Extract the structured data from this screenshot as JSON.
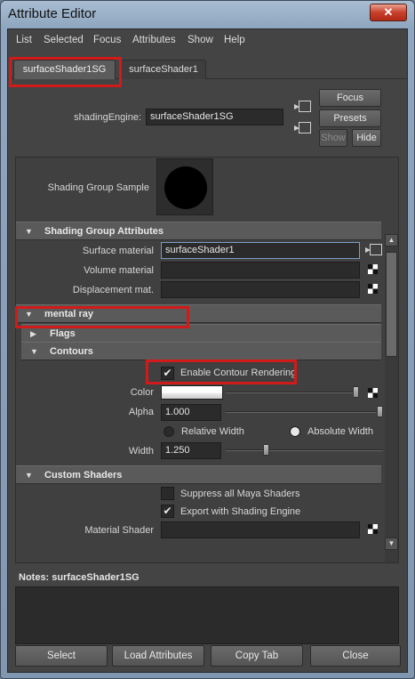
{
  "window": {
    "title": "Attribute Editor",
    "close_glyph": "✕"
  },
  "menu": [
    "List",
    "Selected",
    "Focus",
    "Attributes",
    "Show",
    "Help"
  ],
  "tabs": [
    "surfaceShader1SG",
    "surfaceShader1"
  ],
  "header": {
    "node_label": "shadingEngine:",
    "node_value": "surfaceShader1SG",
    "focus": "Focus",
    "presets": "Presets",
    "show": "Show",
    "hide": "Hide"
  },
  "sample": {
    "label": "Shading Group Sample"
  },
  "sections": {
    "sga": "Shading Group Attributes",
    "mental_ray": "mental ray",
    "flags": "Flags",
    "contours": "Contours",
    "custom": "Custom Shaders"
  },
  "sga": {
    "surface_label": "Surface material",
    "surface_value": "surfaceShader1",
    "volume_label": "Volume material",
    "displacement_label": "Displacement mat."
  },
  "contours": {
    "enable_label": "Enable Contour Rendering",
    "enable_checked": "✔",
    "color_label": "Color",
    "color_value": "#ffffff",
    "alpha_label": "Alpha",
    "alpha_value": "1.000",
    "relative_width": "Relative Width",
    "absolute_width": "Absolute Width",
    "width_label": "Width",
    "width_value": "1.250"
  },
  "custom": {
    "suppress_label": "Suppress all Maya Shaders",
    "export_label": "Export with Shading Engine",
    "export_checked": "✔",
    "material_label": "Material Shader"
  },
  "notes": {
    "label": "Notes:  surfaceShader1SG"
  },
  "buttons": [
    "Select",
    "Load Attributes",
    "Copy Tab",
    "Close"
  ],
  "icons": {
    "section_open": "▼",
    "section_closed": "▶",
    "scroll_up": "▲",
    "scroll_down": "▼"
  },
  "colors": {
    "highlight": "#d11a1a",
    "panel": "#444444",
    "field": "#2b2b2b"
  }
}
